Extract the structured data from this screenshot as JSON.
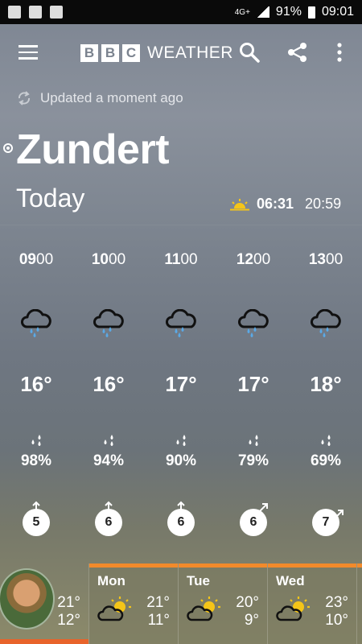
{
  "status_bar": {
    "network": "4G+",
    "battery": "91%",
    "time": "09:01"
  },
  "app": {
    "logo_letters": [
      "B",
      "B",
      "C"
    ],
    "logo_word": "WEATHER"
  },
  "header": {
    "updated": "Updated a moment ago",
    "location": "Zundert",
    "day": "Today",
    "sunrise": "06:31",
    "sunset": "20:59"
  },
  "hours": [
    {
      "time_bold": "09",
      "time_rest": "00",
      "temp": "16°",
      "precip": "98%",
      "wind": "5",
      "wind_dir": "N"
    },
    {
      "time_bold": "10",
      "time_rest": "00",
      "temp": "16°",
      "precip": "94%",
      "wind": "6",
      "wind_dir": "N"
    },
    {
      "time_bold": "11",
      "time_rest": "00",
      "temp": "17°",
      "precip": "90%",
      "wind": "6",
      "wind_dir": "N"
    },
    {
      "time_bold": "12",
      "time_rest": "00",
      "temp": "17°",
      "precip": "79%",
      "wind": "6",
      "wind_dir": "NE"
    },
    {
      "time_bold": "13",
      "time_rest": "00",
      "temp": "18°",
      "precip": "69%",
      "wind": "7",
      "wind_dir": "NE"
    }
  ],
  "days": [
    {
      "name": "",
      "hi": "21°",
      "lo": "12°"
    },
    {
      "name": "Mon",
      "hi": "21°",
      "lo": "11°"
    },
    {
      "name": "Tue",
      "hi": "20°",
      "lo": "9°"
    },
    {
      "name": "Wed",
      "hi": "23°",
      "lo": "10°"
    }
  ],
  "colors": {
    "accent_orange": "#f28a2b",
    "selected_underline": "#e8632a",
    "sun_yellow": "#f5c518",
    "rain_blue": "#5aa9e6"
  },
  "icons": {
    "weather_hourly": "rain-cloud-icon",
    "weather_daily": "sun-cloud-icon",
    "sunrise": "sunrise-icon",
    "refresh": "refresh-icon"
  }
}
